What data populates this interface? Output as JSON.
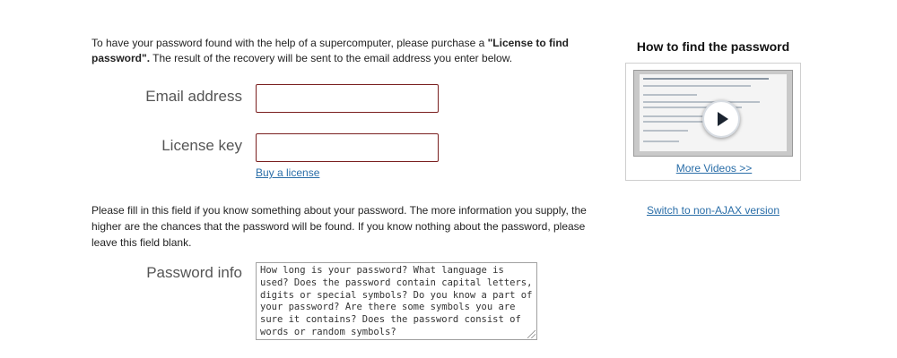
{
  "intro": {
    "text_before": "To have your password found with the help of a supercomputer, please purchase a ",
    "bold": "\"License to find password\".",
    "text_after": " The result of the recovery will be sent to the email address you enter below."
  },
  "form": {
    "email_label": "Email address",
    "email_value": "",
    "license_label": "License key",
    "license_value": "",
    "buy_link": "Buy a license",
    "info_help": "Please fill in this field if you know something about your password. The more information you supply, the higher are the chances that the password will be found. If you know nothing about the password, please leave this field blank.",
    "password_info_label": "Password info",
    "password_info_placeholder": "How long is your password? What language is used? Does the password contain capital letters, digits or special symbols? Do you know a part of your password? Are there some symbols you are sure it contains? Does the password consist of words or random symbols?"
  },
  "sidebar": {
    "video_title": "How to find the password",
    "more_videos": "More Videos >>",
    "switch_link": "Switch to non-AJAX version"
  }
}
